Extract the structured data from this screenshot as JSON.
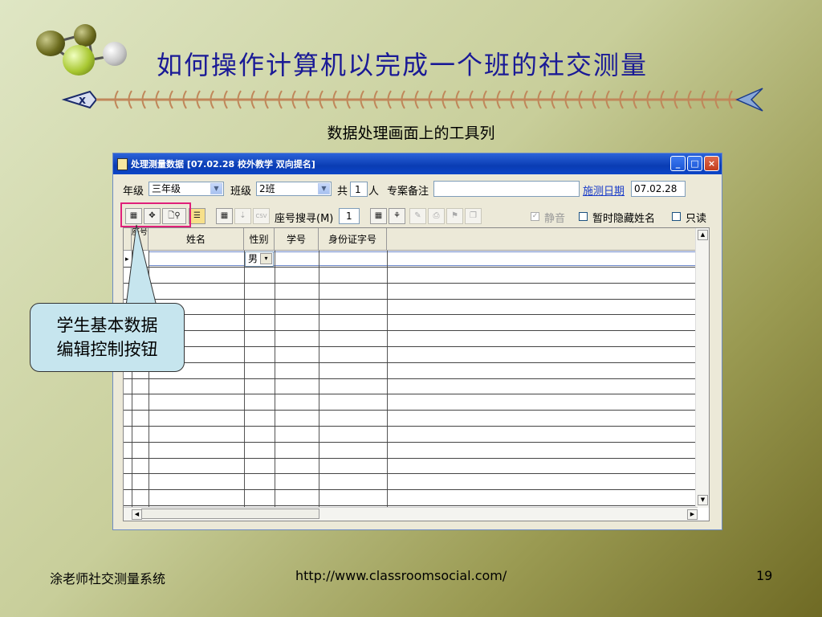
{
  "slide": {
    "title": "如何操作计算机以完成一个班的社交测量",
    "subtitle": "数据处理画面上的工具列",
    "footer_left": "涂老师社交测量系统",
    "footer_url": "http://www.classroomsocial.com/",
    "page_number": "19",
    "callout_line1": "学生基本数据",
    "callout_line2": "编辑控制按钮"
  },
  "window": {
    "title": "处理测量数据 [07.02.28 校外教学 双向提名]",
    "minimize": "_",
    "maximize": "□",
    "close": "×"
  },
  "form": {
    "grade_label": "年级",
    "grade_value": "三年级",
    "class_label": "班级",
    "class_value": "2班",
    "total_label": "共",
    "total_count": "1",
    "total_unit": "人",
    "note_label": "专案备注",
    "note_value": "",
    "date_label": "施测日期",
    "date_value": "07.02.28",
    "seat_search_label": "座号搜寻(M)",
    "seat_search_value": "1",
    "mute_label": "静音",
    "hide_names_label": "暂时隐藏姓名",
    "readonly_label": "只读",
    "csv_label": "CSV"
  },
  "grid": {
    "columns": [
      "座号",
      "姓名",
      "性别",
      "学号",
      "身份证字号"
    ],
    "first_row_gender": "男"
  },
  "colors": {
    "title": "#1a1a96",
    "highlight_box": "#e0207a",
    "callout_fill": "#c6e5ee"
  }
}
